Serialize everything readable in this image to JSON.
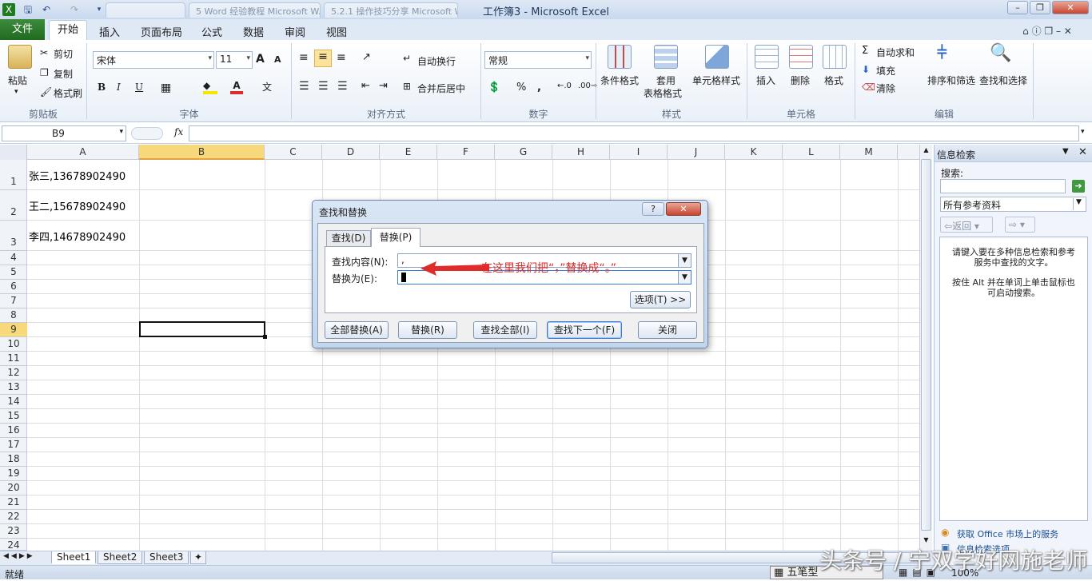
{
  "window": {
    "title": "工作簿3 - Microsoft Excel",
    "ghost_tabs": [
      "5 Word 经验教程 Microsoft W...",
      "5.2.1 操作技巧分享 Microsoft W..."
    ]
  },
  "ribbon_tabs": {
    "file": "文件",
    "home": "开始",
    "insert": "插入",
    "page_layout": "页面布局",
    "formulas": "公式",
    "data": "数据",
    "review": "审阅",
    "view": "视图"
  },
  "clipboard": {
    "paste": "粘贴",
    "cut": "剪切",
    "copy": "复制",
    "format_painter": "格式刷",
    "group": "剪贴板"
  },
  "font": {
    "name": "宋体",
    "size": "11",
    "group": "字体",
    "bold": "B",
    "italic": "I",
    "underline": "U",
    "grow": "A",
    "shrink": "A",
    "font_color": "A"
  },
  "alignment": {
    "wrap": "自动换行",
    "merge": "合并后居中",
    "group": "对齐方式"
  },
  "number": {
    "format": "常规",
    "percent": "%",
    "comma": ",",
    "group": "数字"
  },
  "styles": {
    "conditional": "条件格式",
    "table_line1": "套用",
    "table_line2": "表格格式",
    "cell_styles": "单元格样式",
    "group": "样式"
  },
  "cells": {
    "insert": "插入",
    "delete": "删除",
    "format": "格式",
    "group": "单元格"
  },
  "editing": {
    "autosum": "自动求和",
    "fill": "填充",
    "clear": "清除",
    "sort": "排序和筛选",
    "find": "查找和选择",
    "group": "编辑"
  },
  "formula_bar": {
    "name_box": "B9",
    "fx": "fx",
    "value": ""
  },
  "columns": [
    "A",
    "B",
    "C",
    "D",
    "E",
    "F",
    "G",
    "H",
    "I",
    "J",
    "K",
    "L",
    "M"
  ],
  "rows": [
    "1",
    "2",
    "3",
    "4",
    "5",
    "6",
    "7",
    "8",
    "9",
    "10",
    "11",
    "12",
    "13",
    "14",
    "15",
    "16",
    "17",
    "18",
    "19",
    "20",
    "21",
    "22",
    "23",
    "24"
  ],
  "cells_data": {
    "A1": "张三,13678902490",
    "A2": "王二,15678902490",
    "A3": "李四,14678902490"
  },
  "selected_cell": "B9",
  "sheets": [
    "Sheet1",
    "Sheet2",
    "Sheet3"
  ],
  "status": {
    "ready": "就绪",
    "zoom": "100%",
    "ime": "五笔型"
  },
  "side_panel": {
    "title": "信息检索",
    "search_label": "搜索:",
    "search_value": "",
    "source": "所有参考资料",
    "back": "返回",
    "info1": "请键入要在多种信息检索和参考服务中查找的文字。",
    "info2": "按住 Alt 并在单词上单击鼠标也可启动搜索。",
    "link1": "获取 Office 市场上的服务",
    "link2": "信息检索选项"
  },
  "dialog": {
    "title": "查找和替换",
    "tab_find": "查找(D)",
    "tab_replace": "替换(P)",
    "find_label": "查找内容(N):",
    "find_value": ",",
    "replace_label": "替换为(E):",
    "replace_value": "",
    "options": "选项(T) >>",
    "replace_all": "全部替换(A)",
    "replace": "替换(R)",
    "find_all": "查找全部(I)",
    "find_next": "查找下一个(F)",
    "close": "关闭"
  },
  "annotation": "在这里我们把“，”替换成“。”",
  "watermark": "头条号 / 宁双学好网施老师",
  "colors": {
    "accent_red": "#e02b2b",
    "file_tab_green": "#2a7a2b",
    "selected_col": "#f7d97c"
  }
}
